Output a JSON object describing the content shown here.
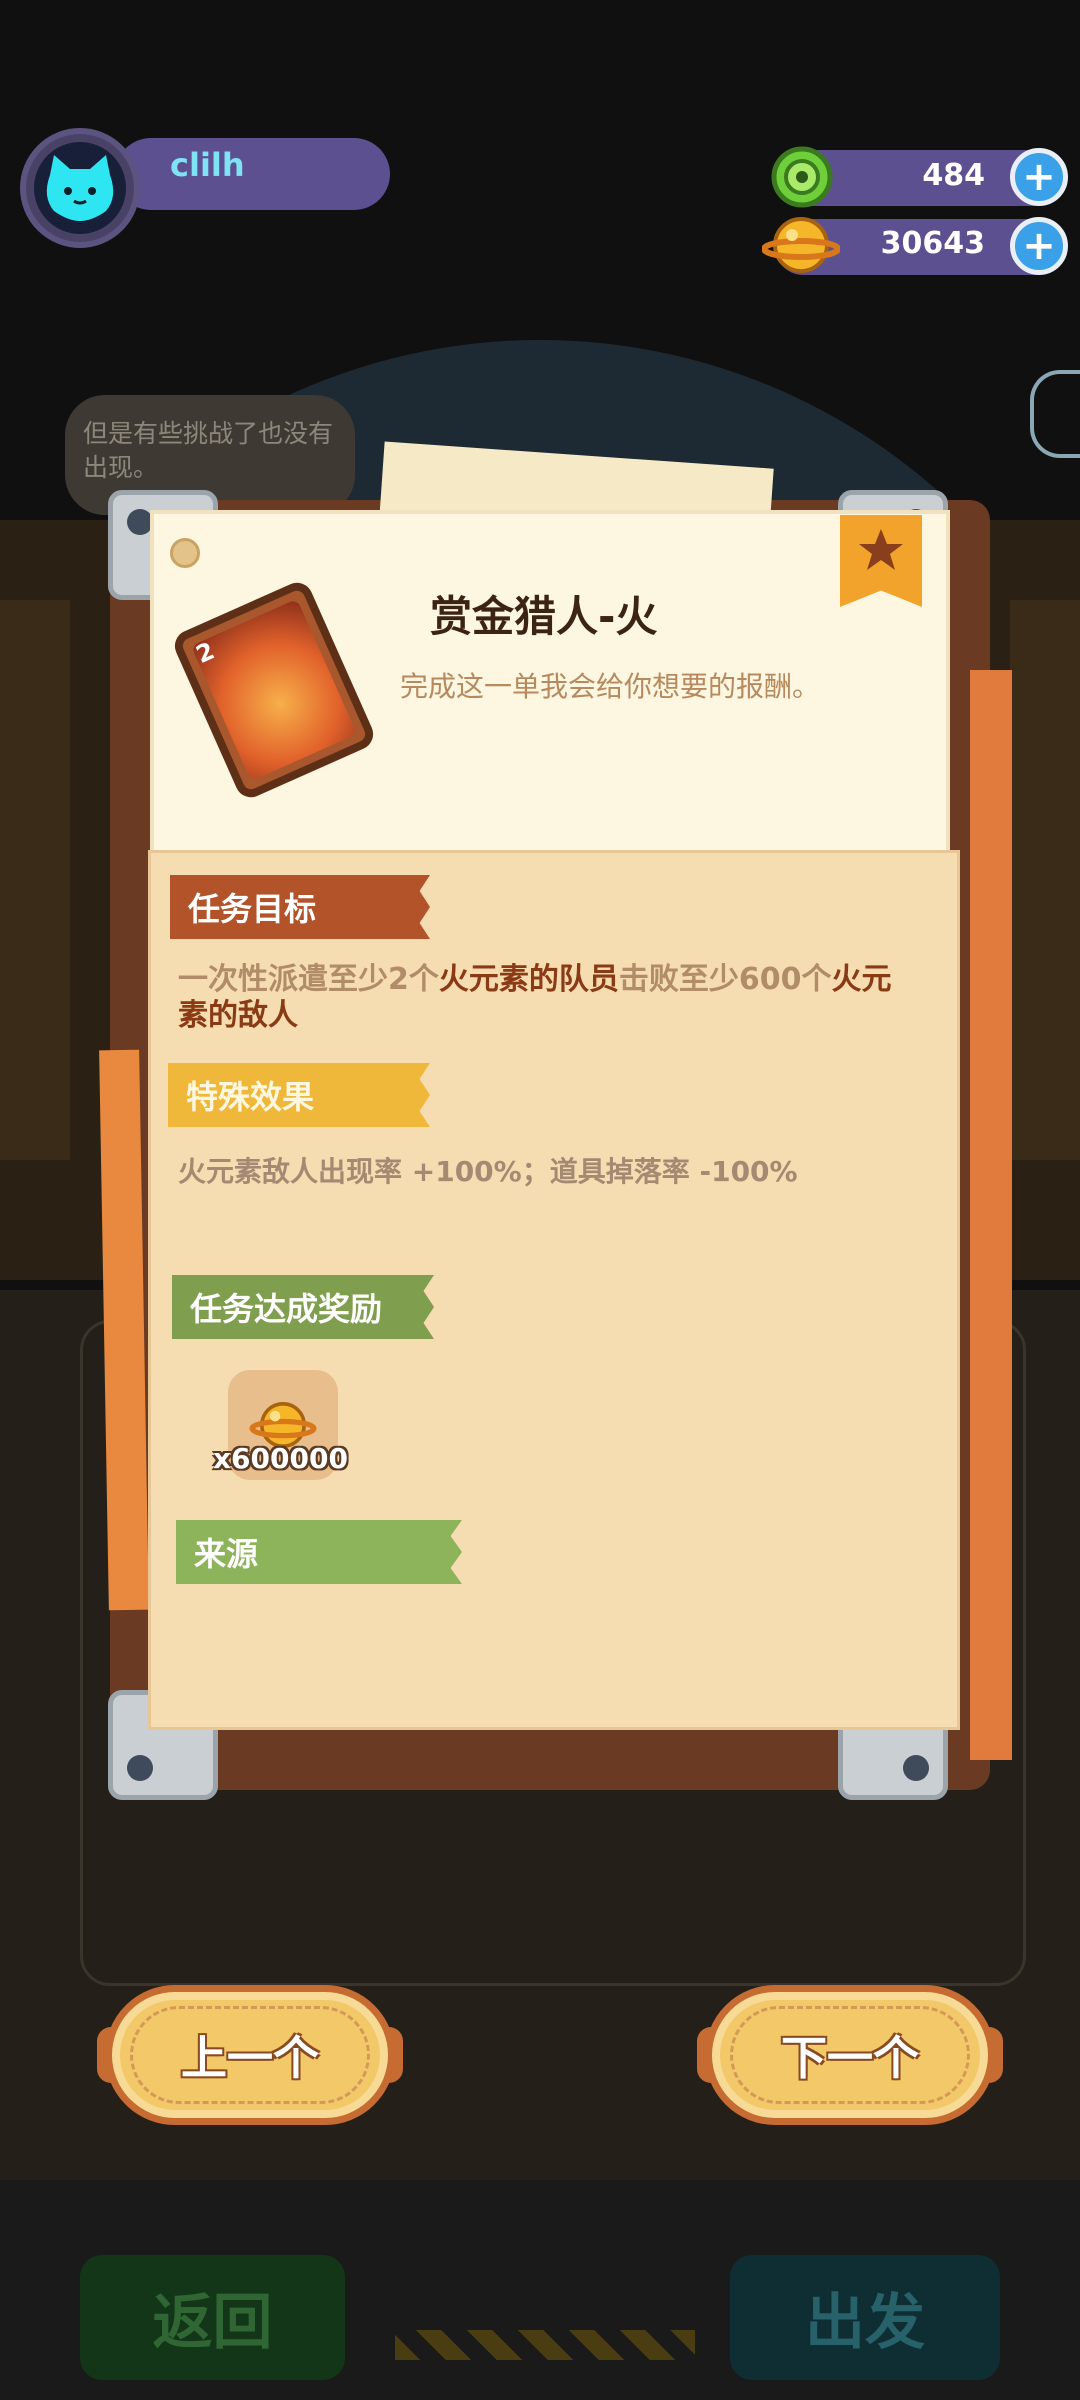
{
  "player": {
    "name": "clilh"
  },
  "resources": {
    "gems": {
      "value": "484",
      "icon": "green-donut-gem-icon"
    },
    "coins": {
      "value": "30643",
      "icon": "gold-planet-coin-icon"
    },
    "plus_symbol": "+"
  },
  "background": {
    "speech_bubble": "但是有些挑战了也没有出现。",
    "back_button": "返回",
    "go_button": "出发"
  },
  "quest": {
    "title": "赏金猎人-火",
    "description": "完成这一单我会给你想要的报酬。",
    "badge_level": "2",
    "sections": {
      "goal_label": "任务目标",
      "effect_label": "特殊效果",
      "reward_label": "任务达成奖励",
      "source_label": "来源"
    },
    "goal_text": {
      "part1": "一次性派遣至少2个",
      "highlight1": "火元素的队员",
      "part2": "击败至少600个",
      "highlight2": "火元素的敌人"
    },
    "effect_text": "火元素敌人出现率 +100%；道具掉落率 -100%",
    "reward": {
      "icon": "gold-planet-coin-icon",
      "quantity": "x600000"
    }
  },
  "navigation": {
    "prev_label": "上一个",
    "next_label": "下一个"
  },
  "colors": {
    "accent_orange": "#c66b32",
    "name_cyan": "#7fe3f3",
    "hud_purple": "#5d5091",
    "plus_blue": "#3aa0e8"
  }
}
